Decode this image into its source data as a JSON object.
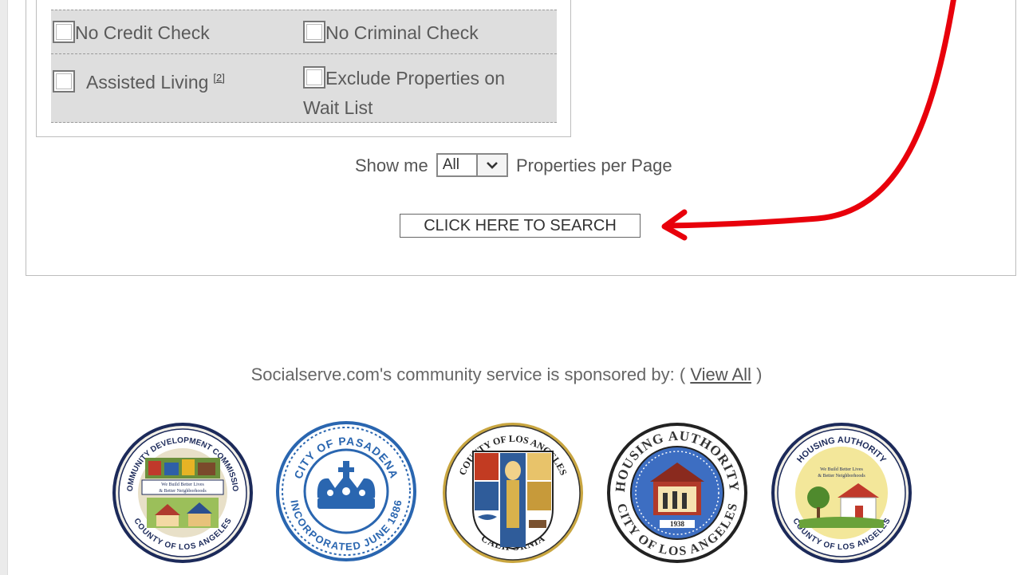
{
  "filters": {
    "no_credit_check": "No Credit Check",
    "no_criminal_check": "No Criminal Check",
    "assisted_living": "Assisted Living",
    "assisted_living_note": "[2]",
    "exclude_waitlist_line1": "Exclude Properties on",
    "exclude_waitlist_line2": "Wait List"
  },
  "pagination": {
    "prefix": "Show me",
    "selected": "All",
    "suffix": "Properties per Page"
  },
  "search_button": "CLICK HERE TO SEARCH",
  "sponsors": {
    "text": "Socialserve.com's community service is sponsored by: (",
    "link": "View All",
    "close": ")"
  },
  "seals": {
    "cdc": {
      "top": "COMMUNITY DEVELOPMENT COMMISSION",
      "bottom": "COUNTY OF LOS ANGELES",
      "motto1": "We Build Better Lives",
      "motto2": "& Better Neighborhoods"
    },
    "pasadena": {
      "top": "CITY OF PASADENA",
      "bottom": "INCORPORATED JUNE 1886"
    },
    "la_county": {
      "top": "COUNTY OF LOS ANGELES",
      "bottom": "CALIFORNIA"
    },
    "hacla": {
      "top": "HOUSING AUTHORITY",
      "bottom": "CITY OF LOS ANGELES",
      "year": "1938"
    },
    "hacola": {
      "top": "HOUSING AUTHORITY",
      "bottom": "COUNTY OF LOS ANGELES",
      "motto1": "We Build Better Lives",
      "motto2": "& Better Neighborhoods"
    }
  },
  "colors": {
    "annotation_arrow": "#e8000b"
  }
}
